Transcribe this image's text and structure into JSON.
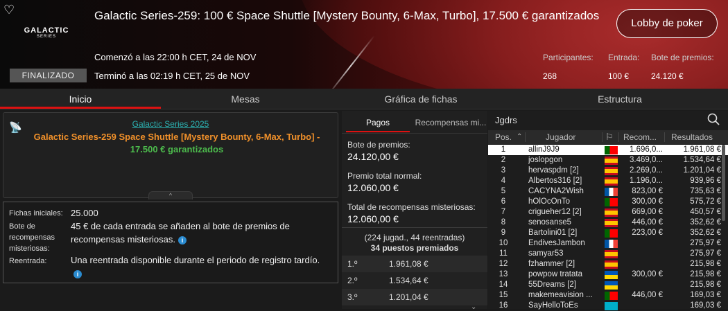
{
  "header": {
    "title": "Galactic Series-259: 100 € Space Shuttle [Mystery Bounty, 6-Max, Turbo], 17.500 € garantizados",
    "logo_line1": "GALACTIC",
    "logo_line2": "SERIES",
    "started": "Comenzó a las 22:00 h CET, 24 de NOV",
    "ended": "Terminó a las 02:19 h CET, 25 de NOV",
    "status": "FINALIZADO",
    "lobby_button": "Lobby de poker",
    "stats": [
      {
        "label": "Participantes:",
        "value": "268"
      },
      {
        "label": "Entrada:",
        "value": "100 €"
      },
      {
        "label": "Bote de premios:",
        "value": "24.120 €"
      }
    ]
  },
  "tabs": [
    "Inicio",
    "Mesas",
    "Gráfica de fichas",
    "Estructura"
  ],
  "info": {
    "series_link": "Galactic Series 2025",
    "title_main": "Galactic Series-259 Space Shuttle [Mystery Bounty, 6-Max, Turbo]",
    "title_sep": " - ",
    "title_guarantee": "17.500 € garantizados",
    "collapse_icon": "^"
  },
  "details": {
    "chips_label": "Fichas iniciales:",
    "chips_value": "25.000",
    "bounty_label": "Bote de recompensas misteriosas:",
    "bounty_value": "45 € de cada entrada se añaden al bote de premios de recompensas misteriosas.",
    "reentry_label": "Reentrada:",
    "reentry_value": "Una reentrada disponible durante el periodo de registro tardío."
  },
  "payouts": {
    "tab_pagos": "Pagos",
    "tab_recompensas": "Recompensas mi...",
    "prize_pool_label": "Bote de premios:",
    "prize_pool_value": "24.120,00 €",
    "normal_label": "Premio total normal:",
    "normal_value": "12.060,00 €",
    "mystery_label": "Total de recompensas misteriosas:",
    "mystery_value": "12.060,00 €",
    "players_line": "(224 jugad., 44 reentradas)",
    "paid_line": "34 puestos premiados",
    "places": [
      {
        "pos": "1.º",
        "amount": "1.961,08 €"
      },
      {
        "pos": "2.º",
        "amount": "1.534,64 €"
      },
      {
        "pos": "3.º",
        "amount": "1.201,04 €"
      }
    ]
  },
  "table": {
    "search_value": "Jgdrs",
    "columns": [
      "Pos.",
      "Jugador",
      "Recom...",
      "Resultados"
    ],
    "rows": [
      {
        "pos": "1",
        "player": "allinJ9J9",
        "flag": "pt",
        "rec": "1.696,0...",
        "res": "1.961,08 €"
      },
      {
        "pos": "2",
        "player": "joslopgon",
        "flag": "es",
        "rec": "3.469,0...",
        "res": "1.534,64 €"
      },
      {
        "pos": "3",
        "player": "hervaspdm [2]",
        "flag": "es",
        "rec": "2.269,0...",
        "res": "1.201,04 €"
      },
      {
        "pos": "4",
        "player": "Albertos316 [2]",
        "flag": "es",
        "rec": "1.196,0...",
        "res": "939,96 €"
      },
      {
        "pos": "5",
        "player": "CACYNA2Wish",
        "flag": "fr",
        "rec": "823,00 €",
        "res": "735,63 €"
      },
      {
        "pos": "6",
        "player": "hOlOcOnTo",
        "flag": "pt",
        "rec": "300,00 €",
        "res": "575,72 €"
      },
      {
        "pos": "7",
        "player": "crigueher12 [2]",
        "flag": "es",
        "rec": "669,00 €",
        "res": "450,57 €"
      },
      {
        "pos": "8",
        "player": "senosanse5",
        "flag": "es",
        "rec": "446,00 €",
        "res": "352,62 €"
      },
      {
        "pos": "9",
        "player": "Bartolini01 [2]",
        "flag": "pt",
        "rec": "223,00 €",
        "res": "352,62 €"
      },
      {
        "pos": "10",
        "player": "EndivesJambon",
        "flag": "fr",
        "rec": "",
        "res": "275,97 €"
      },
      {
        "pos": "11",
        "player": "samyar53",
        "flag": "es",
        "rec": "",
        "res": "275,97 €"
      },
      {
        "pos": "12",
        "player": "fzhammer [2]",
        "flag": "es",
        "rec": "",
        "res": "215,98 €"
      },
      {
        "pos": "13",
        "player": "powpow tratata",
        "flag": "ua",
        "rec": "300,00 €",
        "res": "215,98 €"
      },
      {
        "pos": "14",
        "player": "55Dreams [2]",
        "flag": "ua",
        "rec": "",
        "res": "215,98 €"
      },
      {
        "pos": "15",
        "player": "makemeavision ...",
        "flag": "pt",
        "rec": "446,00 €",
        "res": "169,03 €"
      },
      {
        "pos": "16",
        "player": "SayHelloToEs",
        "flag": "kz",
        "rec": "",
        "res": "169,03 €"
      }
    ]
  }
}
